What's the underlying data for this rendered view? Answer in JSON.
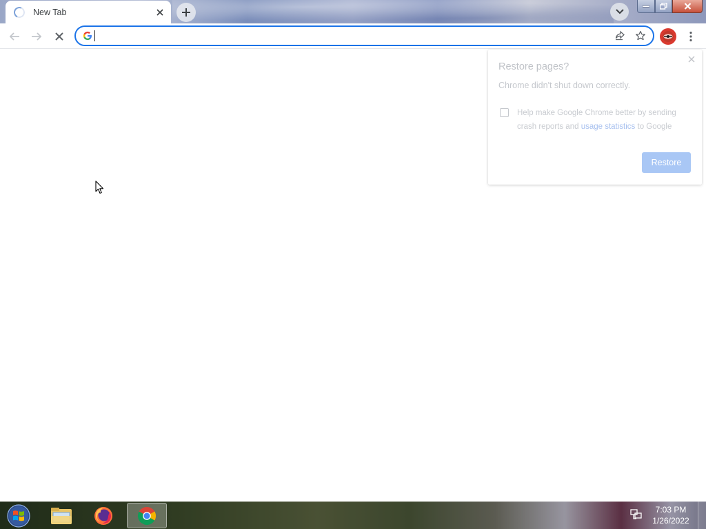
{
  "browser": {
    "tab": {
      "title": "New Tab",
      "icon": "loading-spinner-icon"
    },
    "new_tab_icon": "plus-icon",
    "tab_search_icon": "chevron-down-icon",
    "window_controls": [
      "minimize-icon",
      "maximize-icon",
      "close-icon"
    ]
  },
  "toolbar": {
    "back_icon": "back-arrow-icon",
    "forward_icon": "forward-arrow-icon",
    "stop_icon": "stop-icon",
    "omnibox": {
      "value": "",
      "placeholder": "",
      "engine_icon": "google-g-icon"
    },
    "share_icon": "share-icon",
    "bookmark_icon": "star-icon",
    "profile_icon": "profile-avatar-icon",
    "menu_icon": "kebab-menu-icon"
  },
  "restore_bubble": {
    "title": "Restore pages?",
    "subtitle": "Chrome didn't shut down correctly.",
    "checkbox_text_before": "Help make Google Chrome better by sending crash reports and ",
    "checkbox_link": "usage statistics",
    "checkbox_text_after": " to Google",
    "checkbox_checked": false,
    "restore_button": "Restore",
    "close_icon": "close-icon"
  },
  "taskbar": {
    "start_icon": "windows-start-icon",
    "apps": [
      "file-explorer-icon",
      "firefox-icon",
      "chrome-icon"
    ],
    "active_app": "chrome-icon",
    "tray_icon": "network-icon",
    "time": "7:03 PM",
    "date": "1/26/2022"
  },
  "colors": {
    "accent": "#1a73e8",
    "restore_button_bg": "#a9c7f5"
  }
}
